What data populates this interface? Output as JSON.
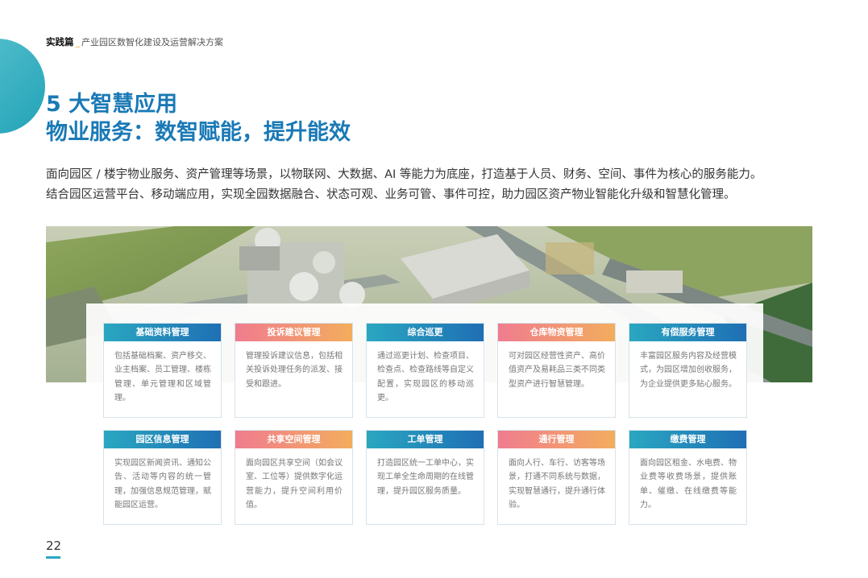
{
  "header": {
    "brand": "实践篇",
    "separator": "_",
    "doc_title": "产业园区数智化建设及运营解决方案"
  },
  "title": {
    "line1": "5 大智慧应用",
    "line2": "物业服务：数智赋能，提升能效"
  },
  "intro": {
    "line1": "面向园区 / 楼宇物业服务、资产管理等场景，以物联网、大数据、AI 等能力为底座，打造基于人员、财务、空间、事件为核心的服务能力。",
    "line2": "结合园区运营平台、移动端应用，实现全园数据融合、状态可观、业务可管、事件可控，助力园区资产物业智能化升级和智慧化管理。"
  },
  "colors": {
    "title": "#1a79b6",
    "accent_teal": "#2aa7c1",
    "accent_orange": "#f3ad5d",
    "accent_pink": "#f07c8f"
  },
  "cards": [
    {
      "title": "基础资料管理",
      "style": "blue",
      "body": "包括基础档案、资产移交、业主档案、员工管理、楼栋管理、单元管理和区域管理。"
    },
    {
      "title": "投诉建议管理",
      "style": "orange",
      "body": "管理投诉建议信息，包括相关投诉处理任务的派发、接受和跟进。"
    },
    {
      "title": "综合巡更",
      "style": "blue",
      "body": "通过巡更计划、检查项目、检查点、检查路线等自定义配置，实现园区的移动巡更。"
    },
    {
      "title": "仓库物资管理",
      "style": "orange",
      "body": "可对园区经营性资产、高价值资产及易耗品三类不同类型资产进行智慧管理。"
    },
    {
      "title": "有偿服务管理",
      "style": "blue",
      "body": "丰富园区服务内容及经营模式，为园区增加创收服务，为企业提供更多贴心服务。"
    },
    {
      "title": "园区信息管理",
      "style": "blue",
      "body": "实现园区新闻资讯、通知公告、活动等内容的统一管理，加强信息规范管理，赋能园区运营。"
    },
    {
      "title": "共享空间管理",
      "style": "orange",
      "body": "面向园区共享空间（如会议室、工位等）提供数字化运营能力，提升空间利用价值。"
    },
    {
      "title": "工单管理",
      "style": "blue",
      "body": "打造园区统一工单中心，实现工单全生命周期的在线管理，提升园区服务质量。"
    },
    {
      "title": "通行管理",
      "style": "orange",
      "body": "面向人行、车行、访客等场景，打通不同系统与数据，实现智慧通行，提升通行体验。"
    },
    {
      "title": "缴费管理",
      "style": "blue",
      "body": "面向园区租金、水电费、物业费等收费场景，提供账单、催缴、在线缴费等能力。"
    }
  ],
  "page_number": "22"
}
